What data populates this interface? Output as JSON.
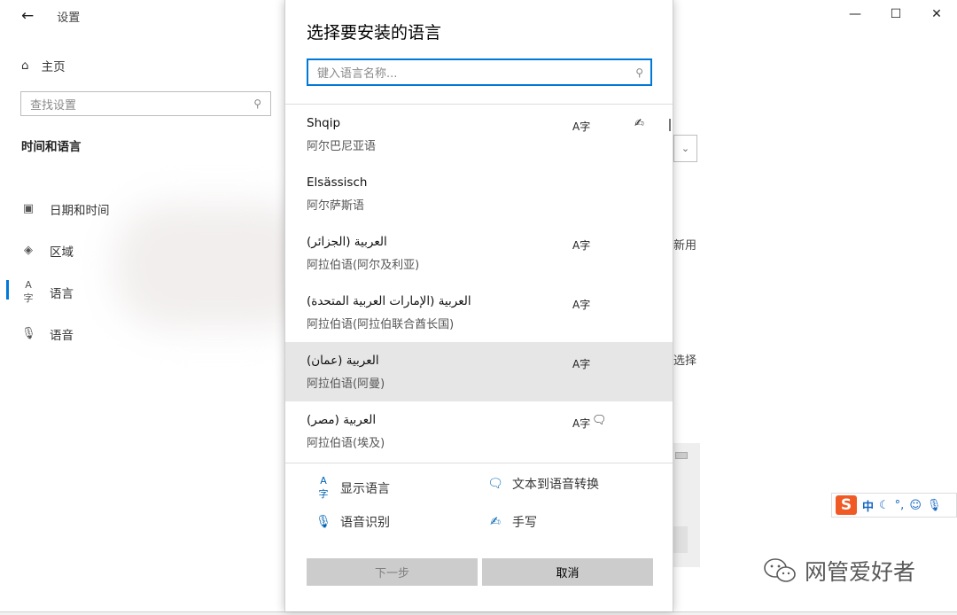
{
  "settings": {
    "app_title": "设置",
    "home_label": "主页",
    "search_placeholder": "查找设置",
    "section_title": "时间和语言",
    "nav": [
      {
        "label": "日期和时间",
        "icon": "calendar-clock-icon"
      },
      {
        "label": "区域",
        "icon": "region-globe-icon"
      },
      {
        "label": "语言",
        "icon": "language-icon"
      },
      {
        "label": "语音",
        "icon": "microphone-icon"
      }
    ],
    "bg_fragments": [
      "新用",
      "选择"
    ]
  },
  "dialog": {
    "title": "选择要安装的语言",
    "search_placeholder": "键入语言名称...",
    "languages": [
      {
        "name": "Shqip",
        "sub": "阿尔巴尼亚语",
        "features": [
          "display-language",
          "handwriting"
        ]
      },
      {
        "name": "Elsässisch",
        "sub": "阿尔萨斯语",
        "features": []
      },
      {
        "name": "العربية (الجزائر)",
        "sub": "阿拉伯语(阿尔及利亚)",
        "features": [
          "display-language"
        ]
      },
      {
        "name": "العربية (الإمارات العربية المتحدة)",
        "sub": "阿拉伯语(阿拉伯联合酋长国)",
        "features": [
          "display-language"
        ]
      },
      {
        "name": "العربية (عمان)",
        "sub": "阿拉伯语(阿曼)",
        "features": [
          "display-language"
        ],
        "selected": true
      },
      {
        "name": "العربية (مصر)",
        "sub": "阿拉伯语(埃及)",
        "features": [
          "display-language",
          "text-to-speech"
        ]
      }
    ],
    "legend": {
      "display_language": "显示语言",
      "text_to_speech": "文本到语音转换",
      "speech_recognition": "语音识别",
      "handwriting": "手写"
    },
    "buttons": {
      "next": "下一步",
      "cancel": "取消"
    }
  },
  "ime": {
    "logo": "S",
    "mode": "中"
  },
  "watermark": "网管爱好者",
  "colors": {
    "accent": "#0078d7",
    "selected_row": "#e6e6e6",
    "button_bg": "#cccccc",
    "ime_brand": "#f05a24"
  }
}
